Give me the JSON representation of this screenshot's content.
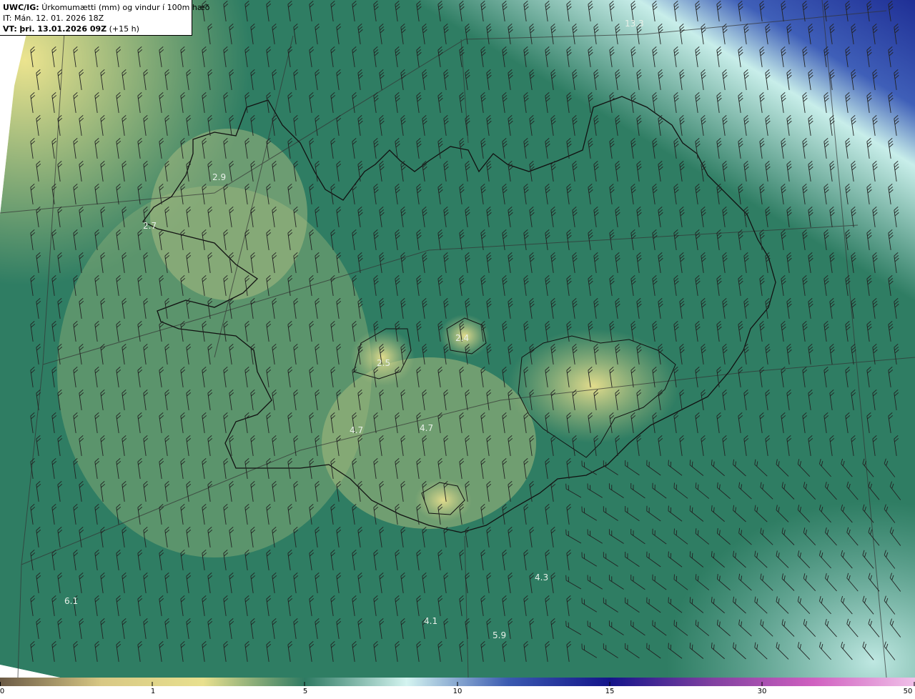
{
  "header": {
    "model_label": "UWC/IG:",
    "title": "Úrkomumætti (mm) og vindur í 100m hæð",
    "issue_time": "IT: Mán. 12. 01. 2026 18Z",
    "valid_label": "VT:",
    "valid_time": "þri. 13.01.2026 09Z",
    "lead_time": "(+15 h)"
  },
  "map_labels": [
    "13.3",
    "2.9",
    "2.7",
    "2.4",
    "2.5",
    "4.7",
    "4.7",
    "4.3",
    "6.1",
    "4.1",
    "5.9"
  ],
  "colorbar": {
    "ticks": [
      "0",
      "1",
      "5",
      "10",
      "15",
      "30",
      "50"
    ],
    "stops": [
      {
        "color": "#6b5a45"
      },
      {
        "color": "#d8c884"
      },
      {
        "color": "#e8e08e"
      },
      {
        "color": "#2e7a62"
      },
      {
        "color": "#d4f4f0"
      },
      {
        "color": "#3a5ab0"
      },
      {
        "color": "#14148a"
      },
      {
        "color": "#8040a0"
      },
      {
        "color": "#d060c0"
      },
      {
        "color": "#f0c0e8"
      }
    ]
  },
  "colors": {
    "low": "#e6df8c",
    "mid": "#2f7d63",
    "high_cyan": "#c6ece8",
    "high_blue": "#2b3fa0",
    "coastline": "#111111"
  },
  "icons": [
    "wind-barb-icon"
  ]
}
